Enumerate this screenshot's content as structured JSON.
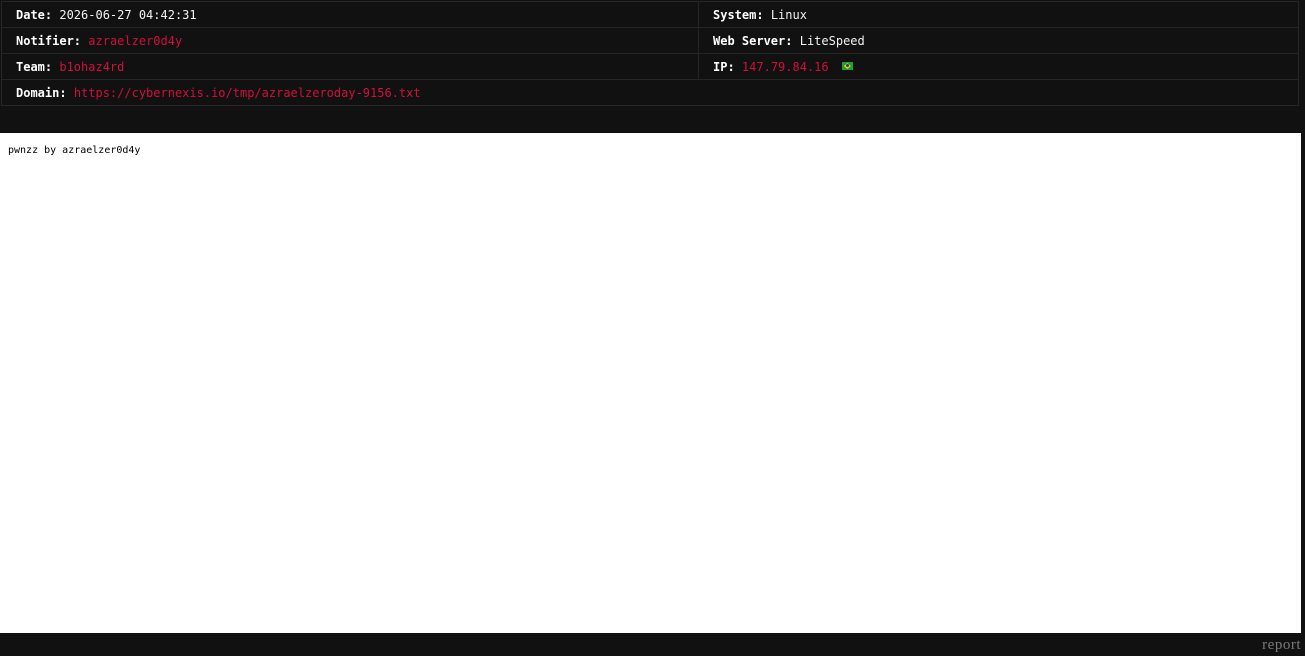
{
  "info": {
    "date_label": "Date:",
    "date_value": "2026-06-27 04:42:31",
    "system_label": "System:",
    "system_value": "Linux",
    "notifier_label": "Notifier:",
    "notifier_value": "azraelzer0d4y",
    "webserver_label": "Web Server:",
    "webserver_value": "LiteSpeed",
    "team_label": "Team:",
    "team_value": "b1ohaz4rd",
    "ip_label": "IP:",
    "ip_value": "147.79.84.16",
    "ip_flag_icon": "brazil-flag-icon",
    "domain_label": "Domain:",
    "domain_value": "https://cybernexis.io/tmp/azraelzeroday-9156.txt"
  },
  "mirror": {
    "content_text": "pwnzz by azraelzer0d4y"
  },
  "footer": {
    "report_label": "report"
  },
  "colors": {
    "background": "#111111",
    "accent_red": "#d0103a",
    "frame_bg": "#ffffff",
    "report_gray": "#7a7a7a"
  }
}
